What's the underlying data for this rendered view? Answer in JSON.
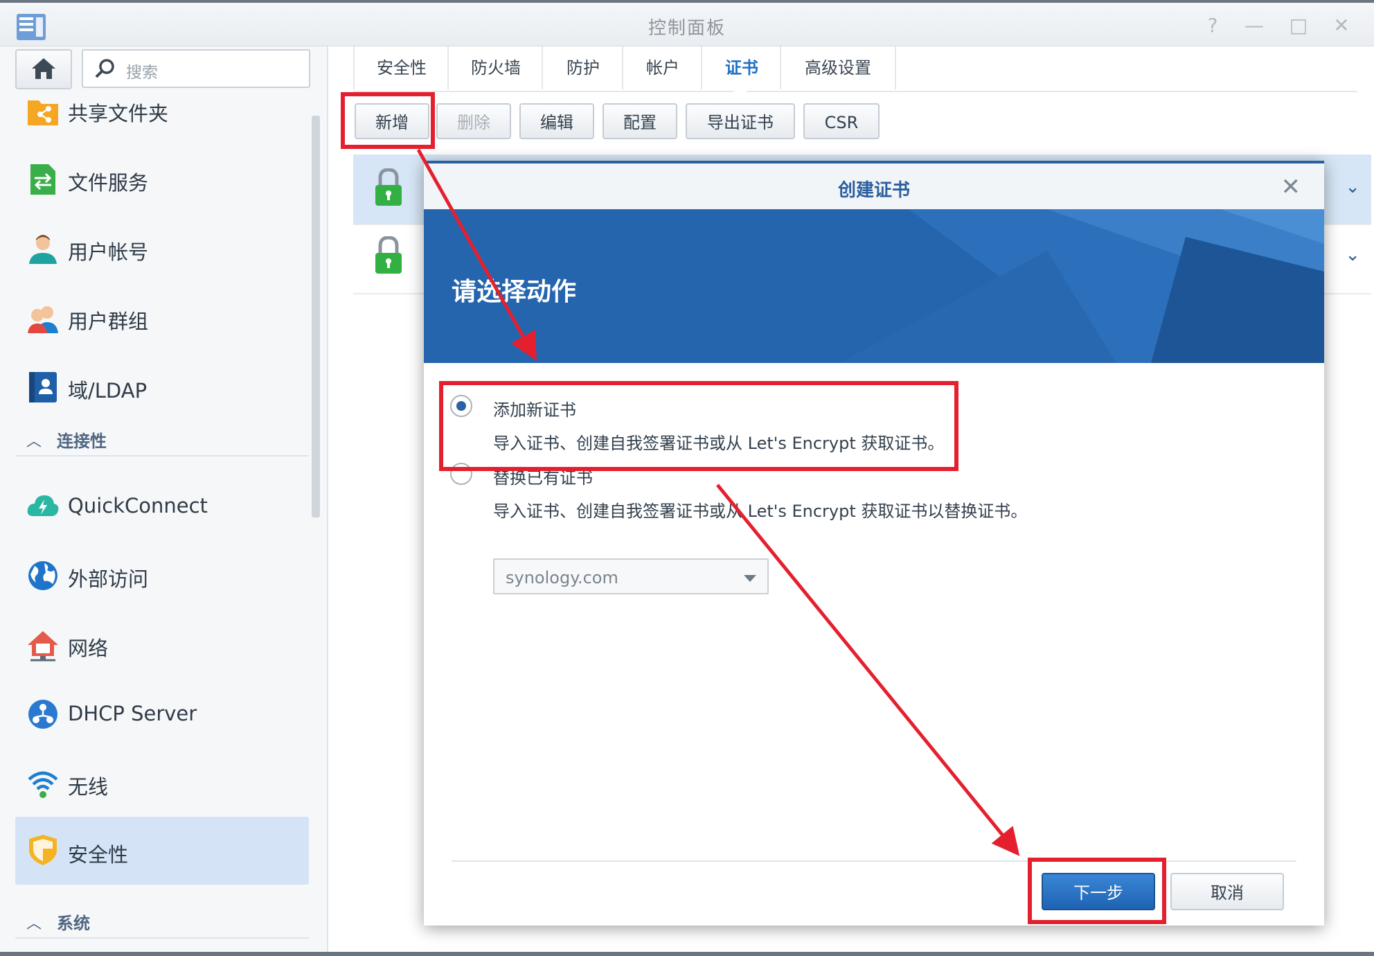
{
  "window": {
    "title": "控制面板",
    "help": "?",
    "minimize": "—",
    "maximize": "□",
    "close": "✕"
  },
  "sidebar": {
    "search_placeholder": "搜索",
    "items": [
      {
        "label": "共享文件夹",
        "icon": "shared-folder-icon"
      },
      {
        "label": "文件服务",
        "icon": "file-services-icon"
      },
      {
        "label": "用户帐号",
        "icon": "user-icon"
      },
      {
        "label": "用户群组",
        "icon": "group-icon"
      },
      {
        "label": "域/LDAP",
        "icon": "ldap-icon"
      }
    ],
    "section_connectivity": "连接性",
    "connectivity_items": [
      {
        "label": "QuickConnect",
        "icon": "quickconnect-icon"
      },
      {
        "label": "外部访问",
        "icon": "globe-icon"
      },
      {
        "label": "网络",
        "icon": "network-icon"
      },
      {
        "label": "DHCP Server",
        "icon": "dhcp-icon"
      },
      {
        "label": "无线",
        "icon": "wifi-icon"
      },
      {
        "label": "安全性",
        "icon": "shield-icon",
        "active": true
      }
    ],
    "section_system": "系统"
  },
  "tabs": [
    "安全性",
    "防火墙",
    "防护",
    "帐户",
    "证书",
    "高级设置"
  ],
  "active_tab": "证书",
  "toolbar": {
    "add": "新增",
    "delete": "删除",
    "edit": "编辑",
    "configure": "配置",
    "export": "导出证书",
    "csr": "CSR"
  },
  "dialog": {
    "title": "创建证书",
    "banner": "请选择动作",
    "option1": {
      "label": "添加新证书",
      "desc": "导入证书、创建自我签署证书或从 Let's Encrypt 获取证书。",
      "selected": true
    },
    "option2": {
      "label": "替换已有证书",
      "desc": "导入证书、创建自我签署证书或从 Let's Encrypt 获取证书以替换证书。",
      "selected": false,
      "select_value": "synology.com"
    },
    "next": "下一步",
    "cancel": "取消"
  },
  "colors": {
    "accent": "#1f6fc5",
    "highlight": "#e5202e",
    "banner": "#2565ad"
  }
}
